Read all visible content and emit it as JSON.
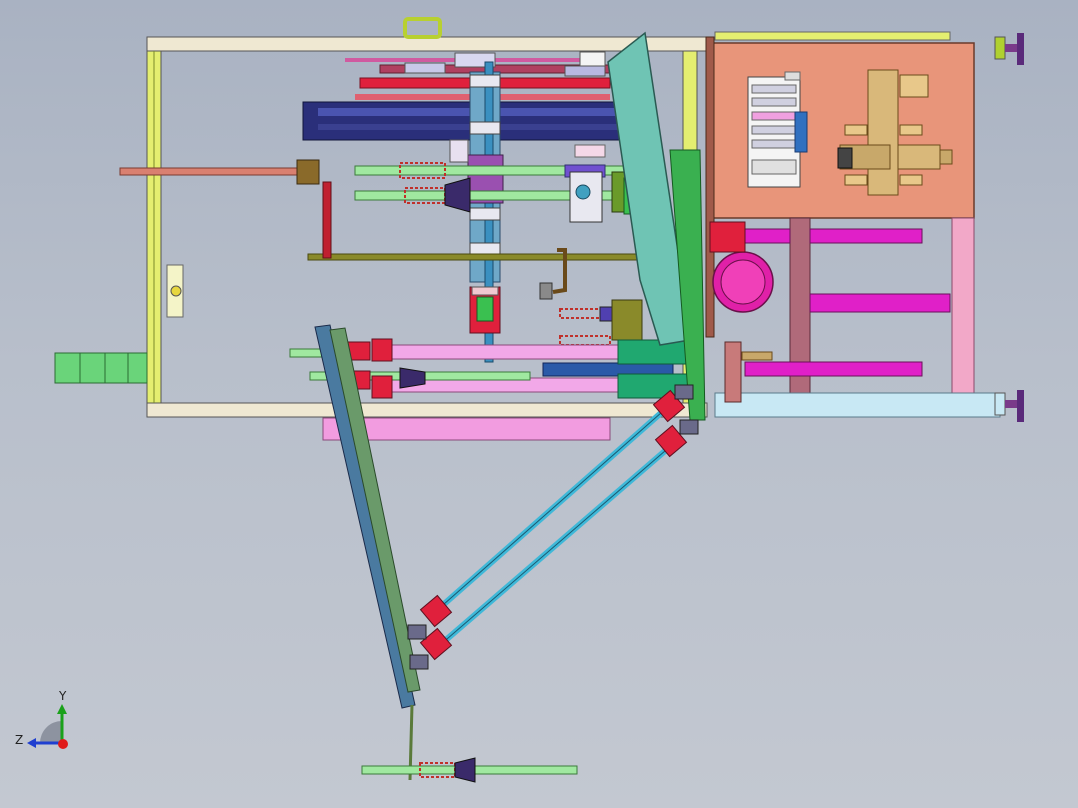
{
  "triad": {
    "y_label": "Y",
    "z_label": "Z",
    "y_color": "#1aa11a",
    "z_color": "#1f3fd0",
    "x_color": "#e01a1a"
  },
  "palette": {
    "frame": "#e8e6a0",
    "frame_edge": "#6b6b2e",
    "control_panel": "#e8957a",
    "pink": "#f29ce0",
    "magenta": "#e020c8",
    "green": "#6ad47a",
    "teal": "#6fc4b4",
    "cyan_rod": "#3fb8d8",
    "red": "#e0203c",
    "navy": "#2a2f7a",
    "olive": "#8a8a2a"
  }
}
